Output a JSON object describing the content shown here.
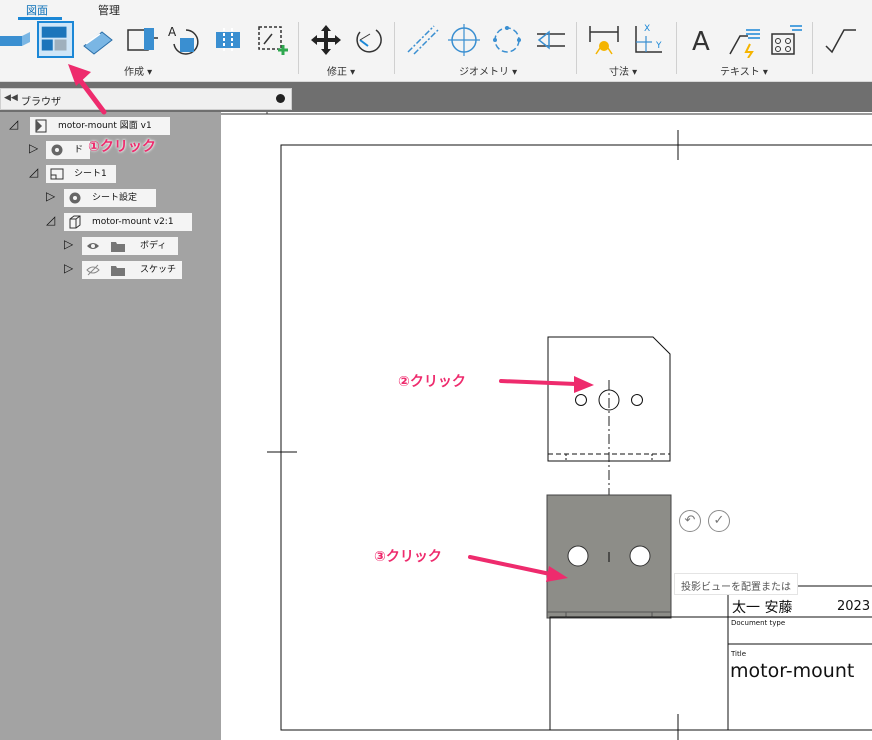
{
  "ribbon": {
    "tabs": [
      {
        "label": "図面",
        "active": true
      },
      {
        "label": "管理",
        "active": false
      }
    ],
    "groups": {
      "create": "作成 ▾",
      "modify": "修正 ▾",
      "geometry": "ジオメトリ ▾",
      "dimension": "寸法 ▾",
      "text": "テキスト ▾"
    }
  },
  "browser": {
    "title": "ブラウザ",
    "nodes": {
      "root": "motor-mount 図面 v1",
      "doc_settings": "ド",
      "sheet1": "シート1",
      "sheet_settings": "シート設定",
      "view": "motor-mount v2:1",
      "bodies": "ボディ",
      "sketches": "スケッチ"
    }
  },
  "canvas": {
    "tooltip": "投影ビューを配置または",
    "title_block": {
      "author": "太一 安藤",
      "year": "2023",
      "doc_type_label": "Document type",
      "title_label": "Title",
      "title_value": "motor-mount"
    }
  },
  "annotations": {
    "step1": "①クリック",
    "step2": "②クリック",
    "step3": "③クリック"
  },
  "colors": {
    "accent_blue": "#1b87d6",
    "annotation_pink": "#ee2b6d",
    "tree_bg": "#a3a3a3",
    "selected_face": "#8d8d88"
  }
}
